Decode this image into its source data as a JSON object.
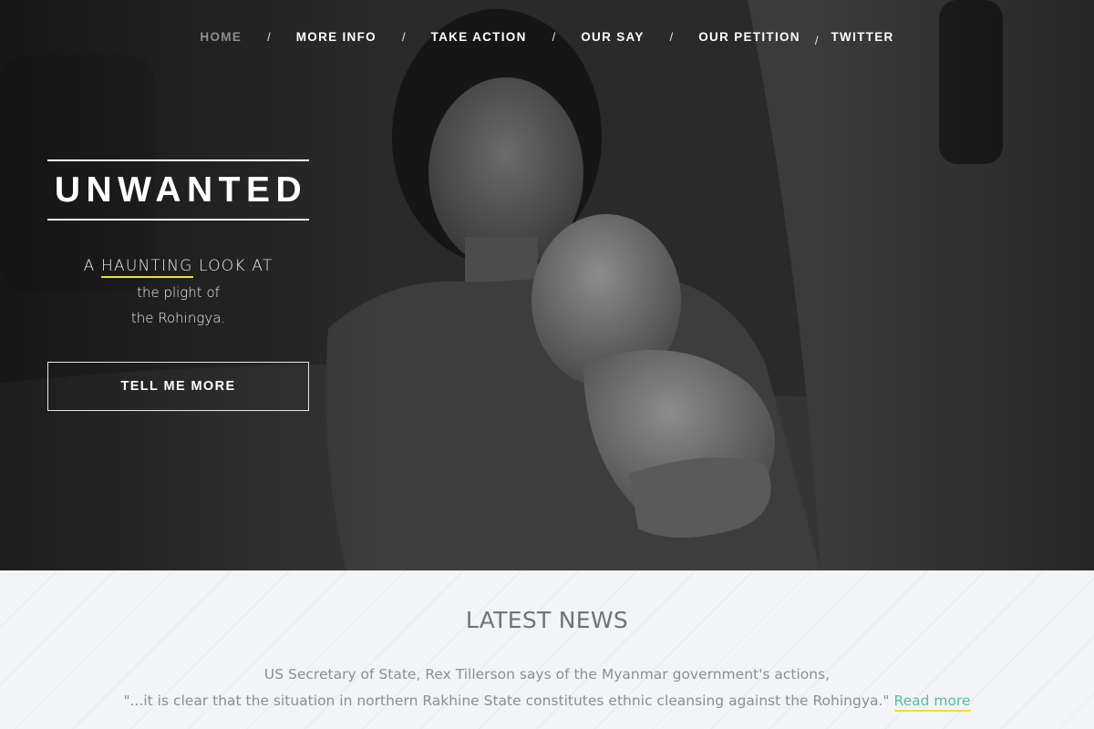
{
  "nav": {
    "items": [
      {
        "label": "HOME",
        "active": true
      },
      {
        "label": "MORE INFO",
        "active": false
      },
      {
        "label": "TAKE ACTION",
        "active": false
      },
      {
        "label": "OUR SAY",
        "active": false
      },
      {
        "label": "OUR PETITION",
        "active": false
      },
      {
        "label": "TWITTER",
        "active": false
      }
    ],
    "separator": "/"
  },
  "hero": {
    "title": "UNWANTED",
    "tagline": {
      "prefix": "A",
      "highlight": "HAUNTING",
      "suffix": "LOOK AT",
      "line2": "the plight of",
      "line3": "the Rohingya."
    },
    "cta_label": "TELL ME MORE",
    "image_description_icon": "photo-mother-and-child"
  },
  "news": {
    "heading": "LATEST NEWS",
    "line1": "US Secretary of State, Rex Tillerson says of the Myanmar government's actions,",
    "line2": "\"...it is clear that the situation in northern Rakhine State constitutes ethnic cleansing against the Rohingya.\"",
    "read_more": "Read more"
  },
  "colors": {
    "highlight_underline": "#e8e337",
    "link": "#5bb7a2",
    "news_bg": "#f2f4f8",
    "nav_active": "#8f8f8f"
  }
}
